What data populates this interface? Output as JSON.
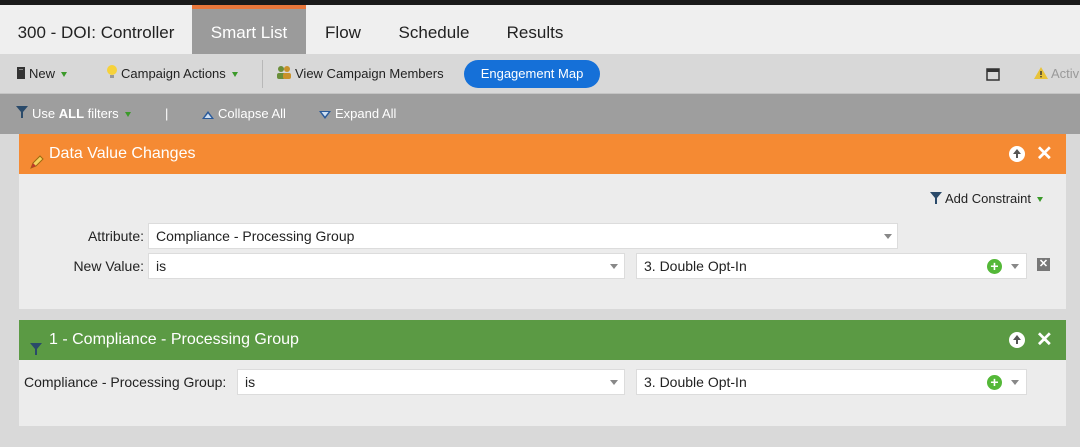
{
  "tabs": {
    "title": "300 - DOI: Controller",
    "smart_list": "Smart List",
    "flow": "Flow",
    "schedule": "Schedule",
    "results": "Results"
  },
  "toolbar": {
    "new": "New",
    "campaign_actions": "Campaign Actions",
    "view_members": "View Campaign Members",
    "engagement_map": "Engagement Map",
    "active": "Activ"
  },
  "filterbar": {
    "use_prefix": "Use ",
    "use_all": "ALL",
    "use_suffix": " filters",
    "separator": "|",
    "collapse_all": "Collapse All",
    "expand_all": "Expand All"
  },
  "trigger": {
    "title": "Data Value Changes",
    "add_constraint": "Add Constraint",
    "attribute_label": "Attribute:",
    "attribute_value": "Compliance - Processing Group",
    "new_value_label": "New Value:",
    "operator": "is",
    "value": "3. Double Opt-In"
  },
  "filter": {
    "title": "1 - Compliance - Processing Group",
    "label": "Compliance - Processing Group:",
    "operator": "is",
    "value": "3. Double Opt-In"
  },
  "colors": {
    "trigger_header": "#f58a33",
    "filter_header": "#5b9a44",
    "accent_button": "#1570d8"
  }
}
